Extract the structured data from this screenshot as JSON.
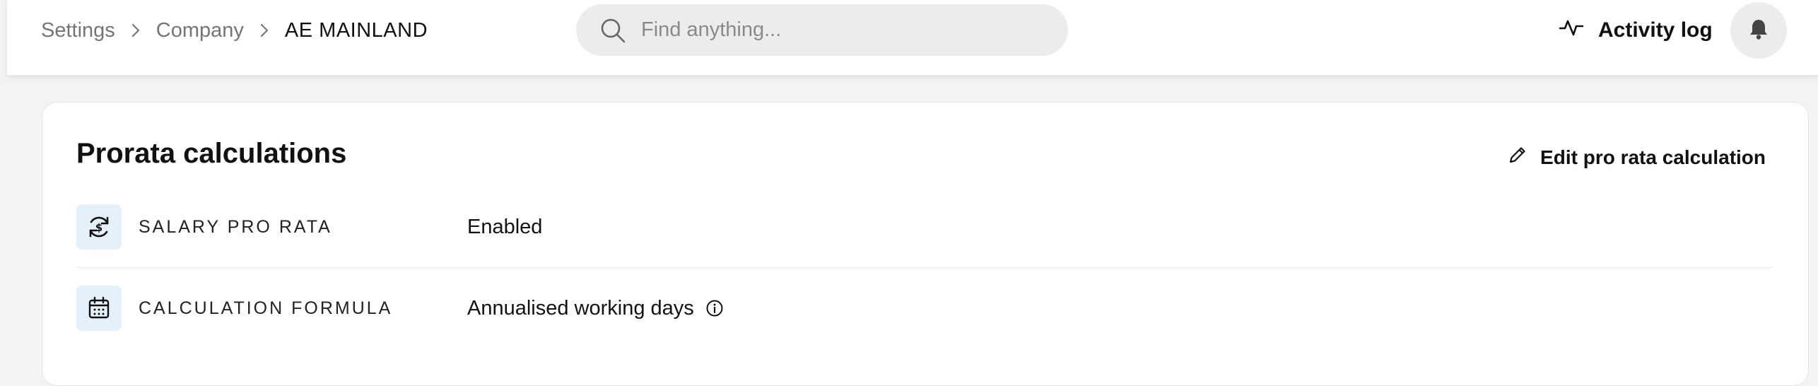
{
  "breadcrumb": {
    "items": [
      "Settings",
      "Company"
    ],
    "current": "AE MAINLAND"
  },
  "search": {
    "placeholder": "Find anything..."
  },
  "header": {
    "activity_log_label": "Activity log"
  },
  "icons": {
    "search": "search-icon",
    "activity": "activity-pulse-icon",
    "bell": "bell-icon",
    "edit": "pencil-icon",
    "salary": "currency-cycle-icon",
    "calendar": "calendar-icon",
    "info": "info-icon"
  },
  "colors": {
    "icon_tile_bg": "#e4f1fb",
    "page_bg": "#f3f3f3",
    "search_bg": "#ececec"
  },
  "card": {
    "title": "Prorata calculations",
    "edit_label": "Edit pro rata calculation",
    "rows": [
      {
        "label": "SALARY PRO RATA",
        "value": "Enabled"
      },
      {
        "label": "CALCULATION FORMULA",
        "value": "Annualised working days"
      }
    ]
  }
}
